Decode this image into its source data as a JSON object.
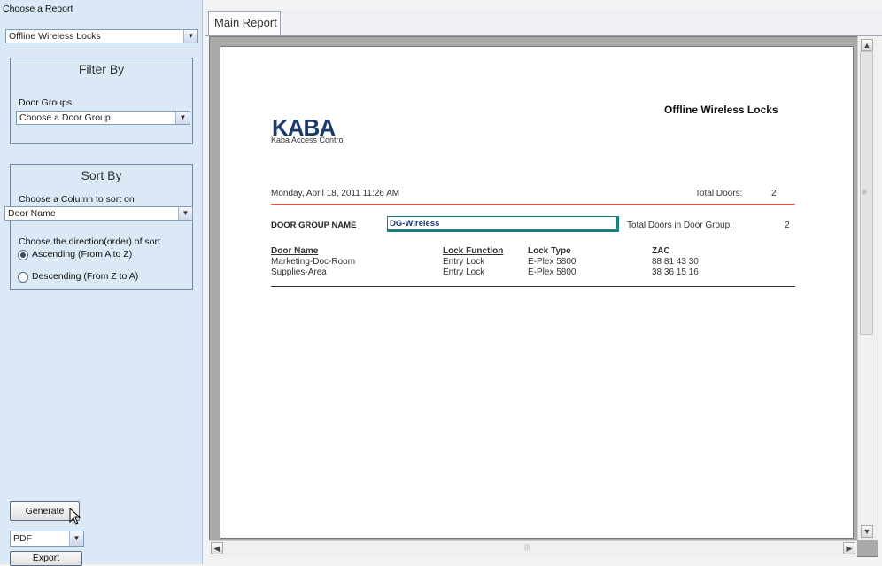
{
  "left_panel": {
    "report_label": "Choose a Report",
    "report_value": "Offline Wireless Locks",
    "filter": {
      "title": "Filter By",
      "door_groups_label": "Door Groups",
      "door_group_value": "Choose a Door Group"
    },
    "sort": {
      "title": "Sort By",
      "column_label": "Choose a Column to sort on",
      "column_value": "Door Name",
      "direction_label": "Choose the direction(order) of sort",
      "ascending": "Ascending (From A to Z)",
      "descending": "Descending (From Z to A)",
      "selected": "ascending"
    },
    "generate_label": "Generate",
    "format_value": "PDF",
    "export_label": "Export"
  },
  "tabs": [
    {
      "label": "Main Report",
      "active": true
    }
  ],
  "report": {
    "logo": "KABA",
    "company": "Kaba Access Control",
    "title": "Offline Wireless Locks",
    "date": "Monday, April 18, 2011 11:26 AM",
    "total_doors_label": "Total Doors:",
    "total_doors": "2",
    "door_group_name_label": "DOOR GROUP NAME",
    "door_group_name": "DG-Wireless",
    "total_in_group_label": "Total Doors in Door Group:",
    "total_in_group": "2",
    "columns": [
      "Door Name",
      "Lock Function",
      "Lock Type",
      "ZAC"
    ],
    "rows": [
      [
        "Marketing-Doc-Room",
        "Entry Lock",
        "E-Plex 5800",
        "88 81 43 30"
      ],
      [
        "Supplies-Area",
        "Entry Lock",
        "E-Plex 5800",
        "38 36 15 16"
      ]
    ],
    "accent_line_color": "#d9534f",
    "highlight_border_color": "#1a7f7f"
  },
  "scroll_glyphs": {
    "up": "▲",
    "down": "▼",
    "left": "◀",
    "right": "▶",
    "grip": "≡",
    "hgrip": "|||"
  }
}
